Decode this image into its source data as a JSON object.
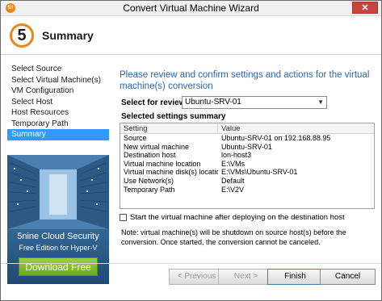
{
  "window": {
    "title": "Convert Virtual Machine Wizard",
    "close_label": "✕",
    "app_icon_label": "5!!"
  },
  "header": {
    "step_number": "5",
    "step_title": "Summary"
  },
  "nav": {
    "items": [
      {
        "label": "Select Source"
      },
      {
        "label": "Select Virtual Machine(s)"
      },
      {
        "label": "VM Configuration"
      },
      {
        "label": "Select Host"
      },
      {
        "label": "Host Resources"
      },
      {
        "label": "Temporary Path"
      },
      {
        "label": "Summary",
        "active": true
      }
    ]
  },
  "promo": {
    "brand": "5nine Cloud Security",
    "edition": "Free Edition for Hyper-V",
    "download_label": "Download Free"
  },
  "main": {
    "heading": "Please review and confirm settings and actions for the virtual machine(s) conversion",
    "review_label": "Select for review:",
    "review_value": "Ubuntu-SRV-01",
    "summary_label": "Selected settings summary",
    "columns": [
      "Setting",
      "Value"
    ],
    "rows": [
      {
        "setting": "Source",
        "value": "Ubuntu-SRV-01 on 192.168.88.95"
      },
      {
        "setting": "New virtual machine",
        "value": "Ubuntu-SRV-01"
      },
      {
        "setting": "Destination host",
        "value": "lon-host3"
      },
      {
        "setting": "Virtual machine location",
        "value": "E:\\VMs"
      },
      {
        "setting": "Virtual machine disk(s) location",
        "value": "E:\\VMs\\Ubuntu-SRV-01"
      },
      {
        "setting": "Use Network(s)",
        "value": "Default"
      },
      {
        "setting": "Temporary Path",
        "value": "E:\\V2V"
      }
    ],
    "start_vm_checkbox_label": "Start the virtual machine after deploying on the destination host",
    "start_vm_checked": false,
    "note": "Note: virtual machine(s) will be shutdown on source host(s) before the conversion. Once started, the conversion cannot be canceled."
  },
  "buttons": {
    "previous": "< Previous",
    "next": "Next >",
    "finish": "Finish",
    "cancel": "Cancel"
  },
  "colors": {
    "accent_orange": "#e8871e",
    "heading_blue": "#2b64b0",
    "selection_blue": "#3399ff",
    "download_green": "#7dbb28",
    "close_red": "#c7453a"
  }
}
